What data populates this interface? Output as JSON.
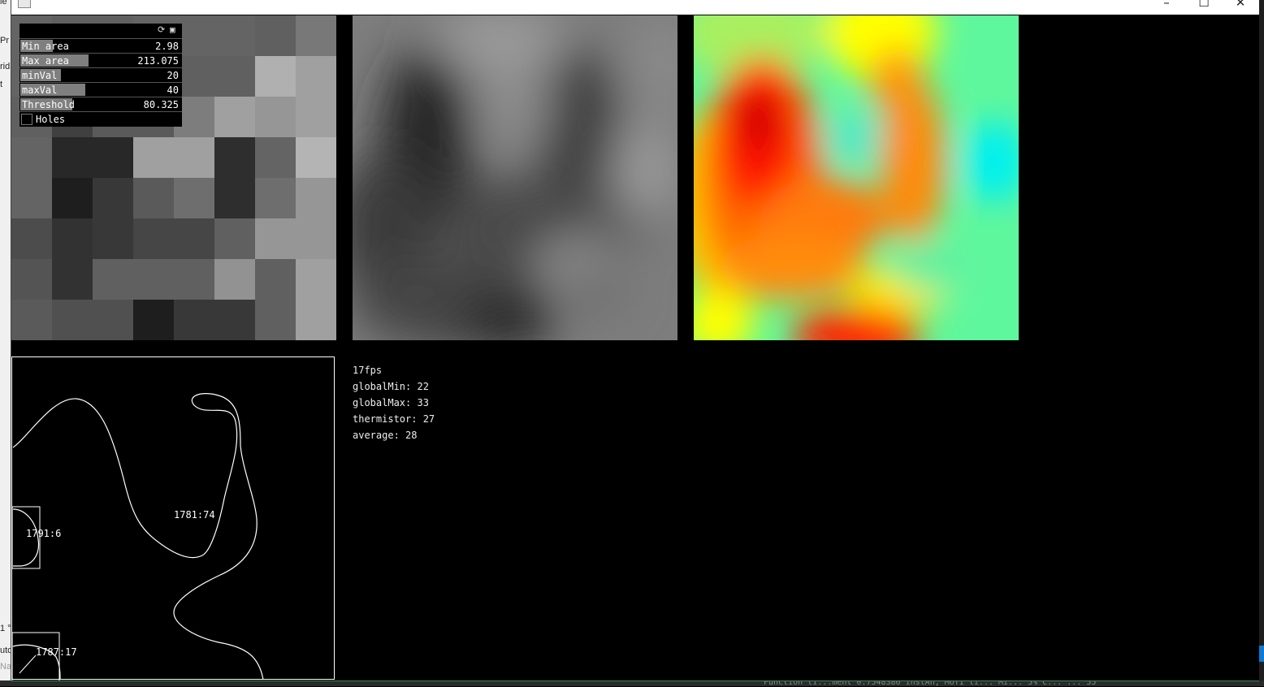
{
  "window": {
    "minimize": "–",
    "maximize": "☐",
    "close": "✕"
  },
  "gui": {
    "sliders": [
      {
        "label": "Min area",
        "value": "2.98",
        "fill": 0.2
      },
      {
        "label": "Max area",
        "value": "213.075",
        "fill": 0.42
      },
      {
        "label": "minVal",
        "value": "20",
        "fill": 0.25
      },
      {
        "label": "maxVal",
        "value": "40",
        "fill": 0.4
      },
      {
        "label": "Threshold",
        "value": "80.325",
        "fill": 0.32
      }
    ],
    "holes": {
      "label": "Holes",
      "checked": false
    },
    "icons": [
      "refresh-icon",
      "save-icon"
    ]
  },
  "stats": {
    "fps": "17fps",
    "global_min": "globalMin: 22",
    "global_max": "globalMax: 33",
    "thermistor": "thermistor: 27",
    "average": "average: 28"
  },
  "contours": [
    {
      "label": "1781:74"
    },
    {
      "label": "1791:6"
    },
    {
      "label": "1787:17"
    }
  ],
  "thermal_grid": {
    "rows": 8,
    "cols": 8,
    "gray_levels": [
      [
        100,
        96,
        96,
        100,
        100,
        100,
        96,
        120
      ],
      [
        100,
        96,
        96,
        96,
        96,
        96,
        176,
        160
      ],
      [
        96,
        64,
        90,
        90,
        125,
        160,
        150,
        160
      ],
      [
        100,
        40,
        40,
        160,
        160,
        46,
        100,
        180
      ],
      [
        100,
        30,
        56,
        90,
        110,
        46,
        110,
        150
      ],
      [
        76,
        50,
        56,
        70,
        70,
        96,
        150,
        150
      ],
      [
        84,
        50,
        96,
        96,
        96,
        146,
        96,
        160
      ],
      [
        90,
        80,
        80,
        30,
        56,
        56,
        96,
        160
      ]
    ]
  },
  "background_text": {
    "left_fragments": [
      "le",
      "Pr",
      "rid",
      "t",
      "1 °",
      "uto",
      "Na"
    ],
    "bottom_status": "Function ti...ment 0.7548386 instAn, MOTI ti... Mi... 5% C... ... 55"
  }
}
